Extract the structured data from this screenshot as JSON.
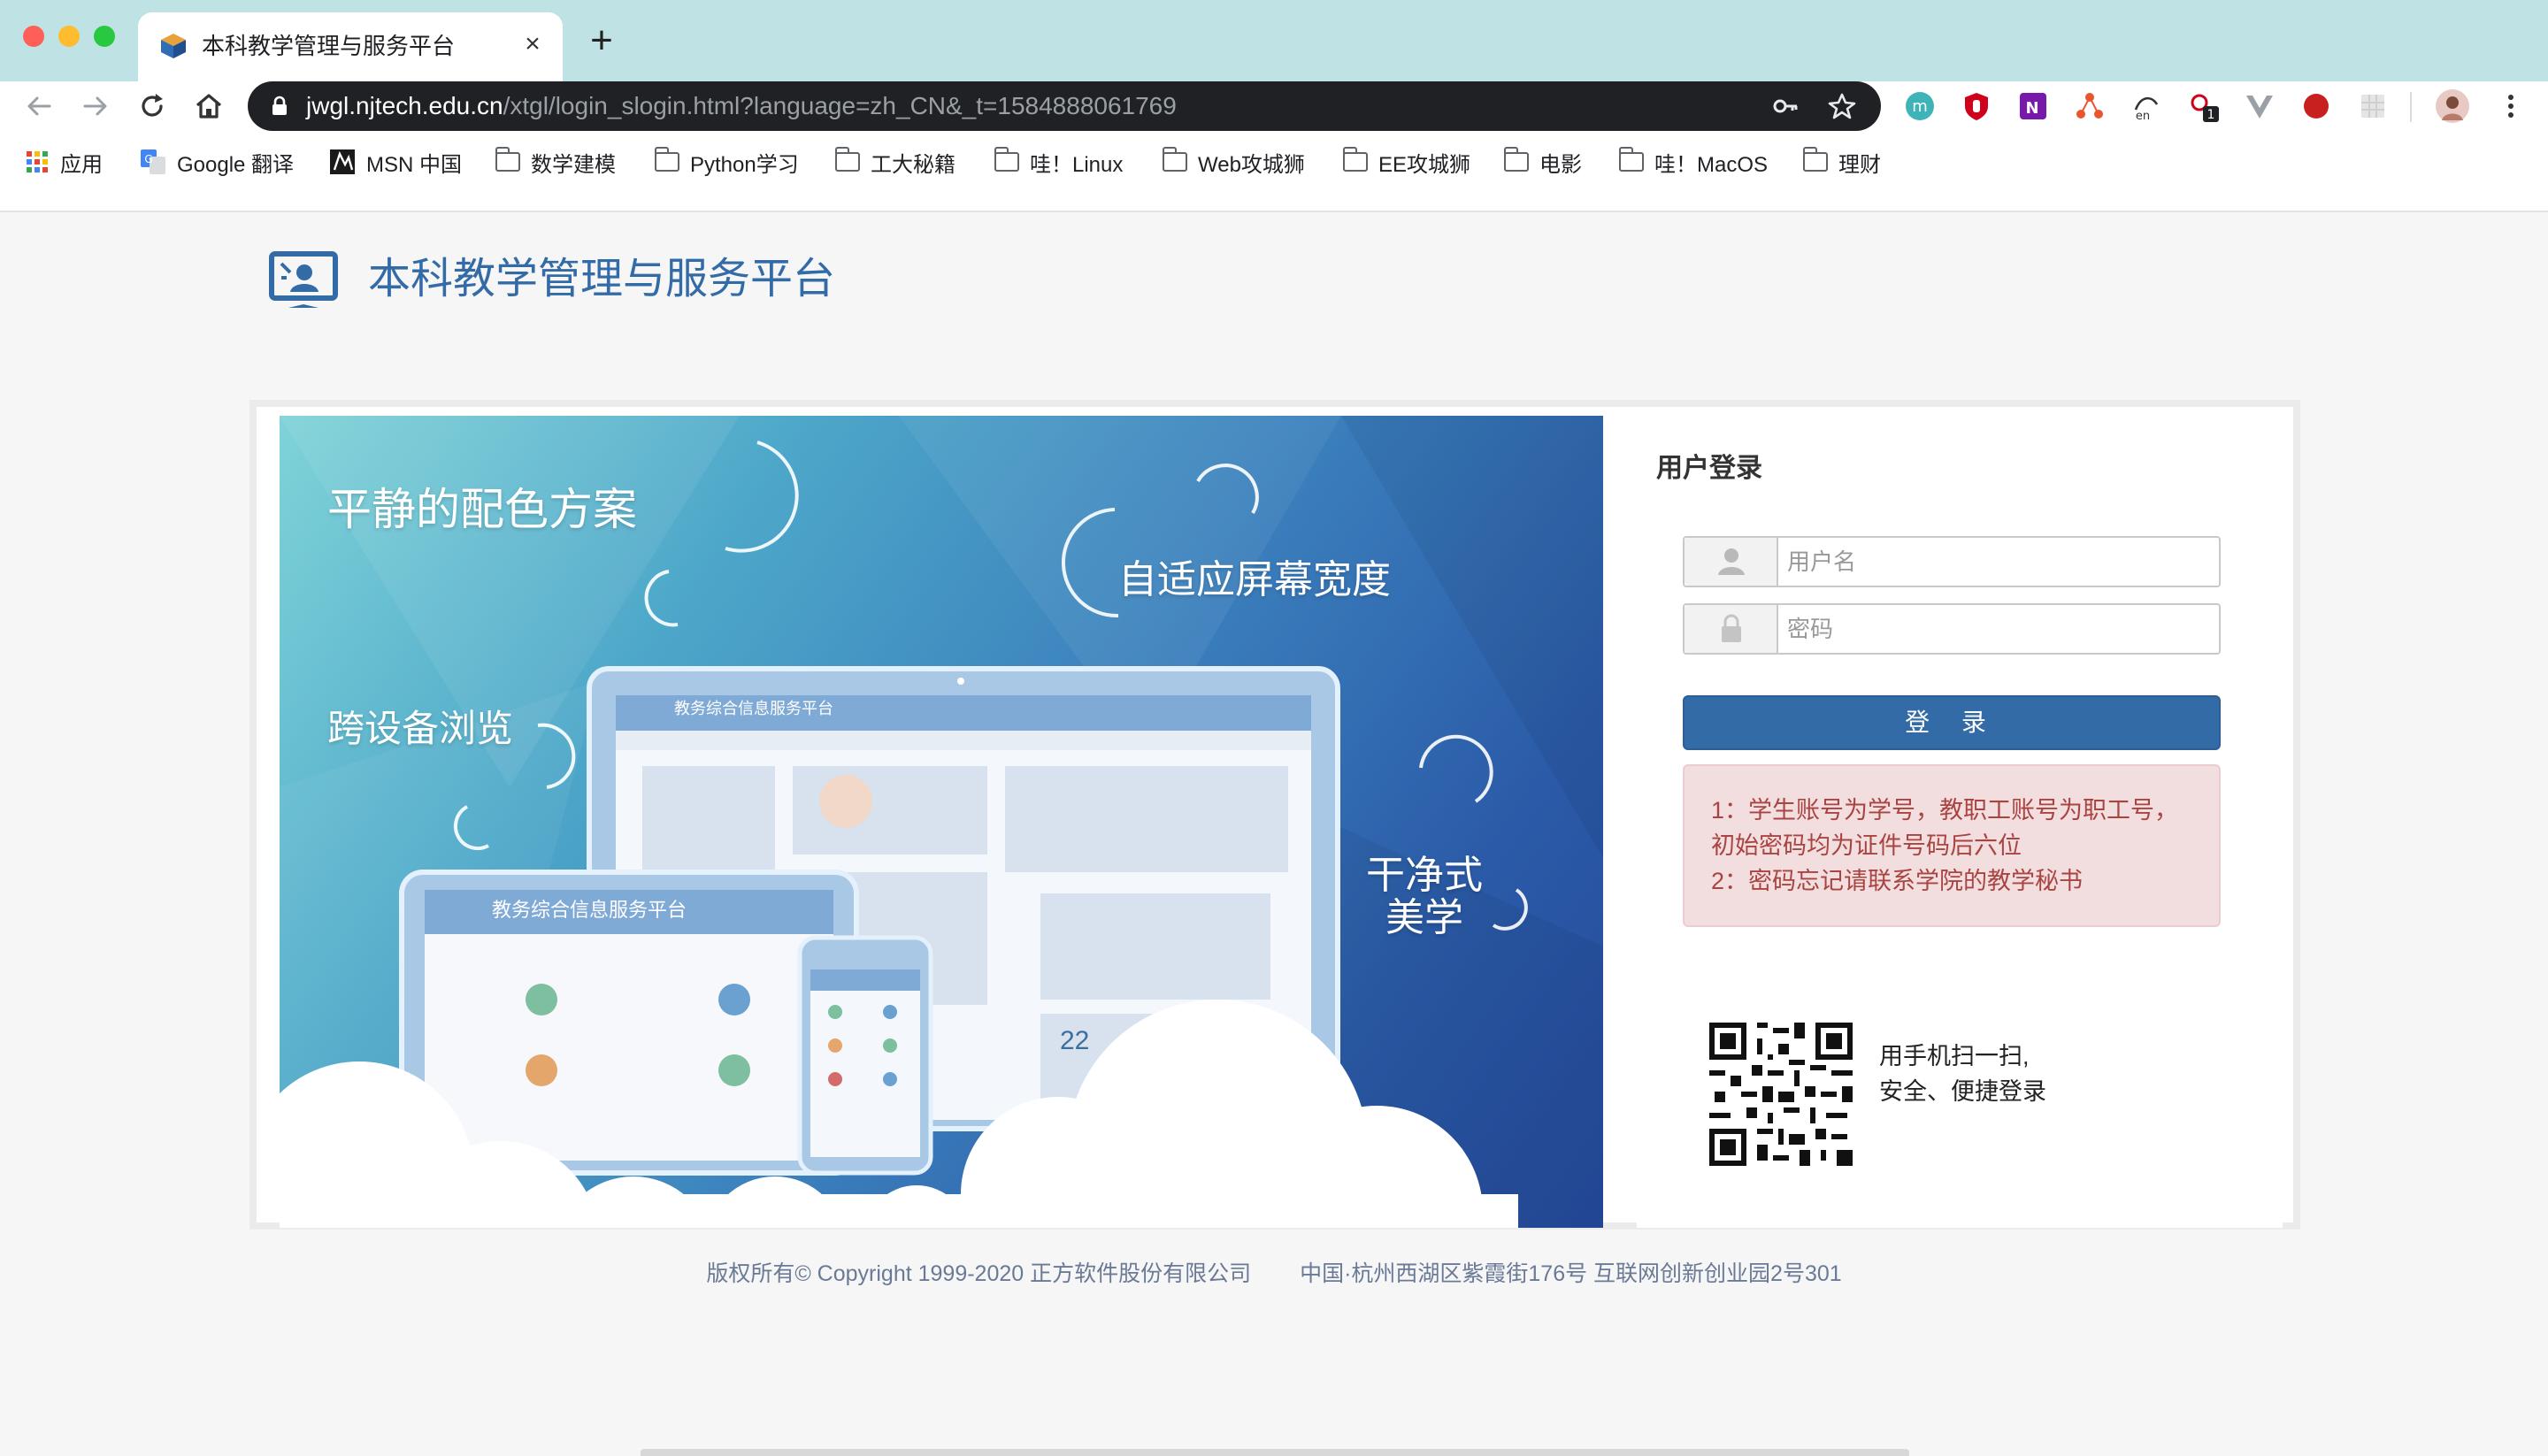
{
  "browser": {
    "tab_title": "本科教学管理与服务平台",
    "tab_close": "×",
    "new_tab": "+",
    "url_host": "jwgl.njtech.edu.cn",
    "url_path": "/xtgl/login_slogin.html?language=zh_CN&_t=1584888061769",
    "extension_badge": "1",
    "bookmarks": [
      {
        "label": "应用",
        "icon": "apps-grid-icon"
      },
      {
        "label": "Google 翻译",
        "icon": "google-translate-icon"
      },
      {
        "label": "MSN 中国",
        "icon": "msn-icon"
      },
      {
        "label": "数学建模",
        "icon": "folder-icon"
      },
      {
        "label": "Python学习",
        "icon": "folder-icon"
      },
      {
        "label": "工大秘籍",
        "icon": "folder-icon"
      },
      {
        "label": "哇！Linux",
        "icon": "folder-icon"
      },
      {
        "label": "Web攻城狮",
        "icon": "folder-icon"
      },
      {
        "label": "EE攻城狮",
        "icon": "folder-icon"
      },
      {
        "label": "电影",
        "icon": "folder-icon"
      },
      {
        "label": "哇！MacOS",
        "icon": "folder-icon"
      },
      {
        "label": "理财",
        "icon": "folder-icon"
      }
    ]
  },
  "header": {
    "title": "本科教学管理与服务平台"
  },
  "banner": {
    "slogan_1": "平静的配色方案",
    "slogan_2": "自适应屏幕宽度",
    "slogan_3": "跨设备浏览",
    "slogan_4a": "干净式",
    "slogan_4b": "美学",
    "mock_title_1": "教务综合信息服务平台",
    "mock_title_2": "教务综合信息服务平台",
    "mock_date": "22"
  },
  "login": {
    "title": "用户登录",
    "username_placeholder": "用户名",
    "password_placeholder": "密码",
    "submit_label": "登 录",
    "notice_line_1": "1：学生账号为学号，教职工账号为职工号，初始密码均为证件号码后六位",
    "notice_line_2": "2：密码忘记请联系学院的教学秘书",
    "qr_line_1": "用手机扫一扫,",
    "qr_line_2": "安全、便捷登录"
  },
  "footer": {
    "copyright": "版权所有© Copyright 1999-2020 正方软件股份有限公司",
    "address": "中国·杭州西湖区紫霞街176号 互联网创新创业园2号301"
  },
  "colors": {
    "brand_blue": "#336ba7",
    "notice_bg": "#f2dede",
    "notice_text": "#a94442"
  }
}
